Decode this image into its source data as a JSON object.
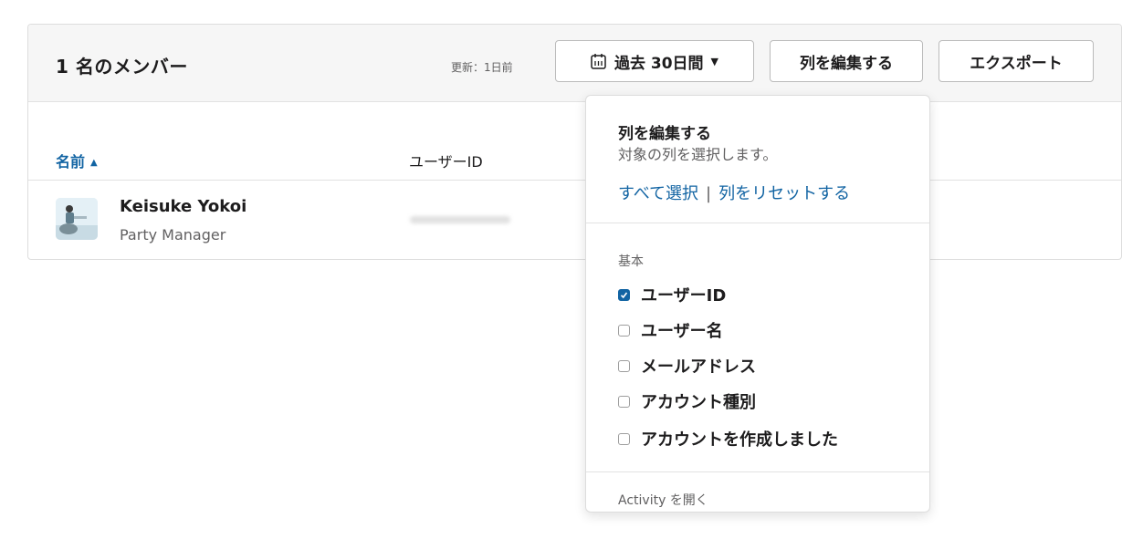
{
  "header": {
    "title": "1 名のメンバー",
    "updated": "更新：1日前",
    "date_range_label": "過去 30日間",
    "edit_columns_label": "列を編集する",
    "export_label": "エクスポート"
  },
  "table": {
    "columns": [
      {
        "label": "名前",
        "sorted": "ascending"
      },
      {
        "label": "ユーザーID"
      }
    ],
    "rows": [
      {
        "name": "Keisuke Yokoi",
        "role": "Party Manager"
      }
    ]
  },
  "menu": {
    "title": "列を編集する",
    "subtitle": "対象の列を選択します。",
    "select_all": "すべて選択",
    "separator": "|",
    "reset": "列をリセットする",
    "section_basic": "基本",
    "options": [
      {
        "label": "ユーザーID",
        "checked": true
      },
      {
        "label": "ユーザー名",
        "checked": false
      },
      {
        "label": "メールアドレス",
        "checked": false
      },
      {
        "label": "アカウント種別",
        "checked": false
      },
      {
        "label": "アカウントを作成しました",
        "checked": false
      }
    ],
    "section_activity": "Activity を開く"
  },
  "colors": {
    "accent": "#1264a3",
    "header_bg": "#f6f6f6",
    "border": "#dddddd"
  },
  "icons": [
    "calendar-icon",
    "caret-down-icon",
    "sort-ascending-icon",
    "checkbox-checked-icon",
    "checkbox-empty-icon"
  ]
}
